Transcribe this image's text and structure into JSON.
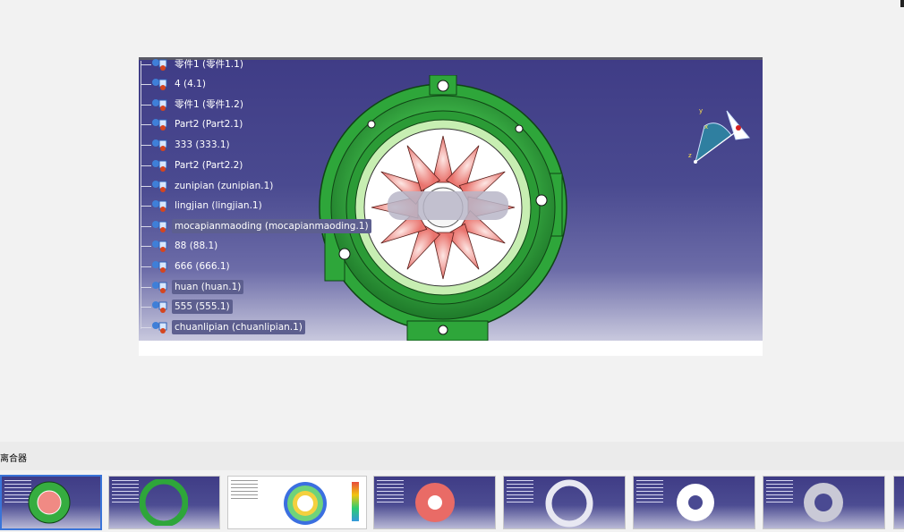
{
  "tree": {
    "items": [
      {
        "label": "零件1 (零件1.1)",
        "selected": false
      },
      {
        "label": "4 (4.1)",
        "selected": false
      },
      {
        "label": "零件1 (零件1.2)",
        "selected": false
      },
      {
        "label": "Part2 (Part2.1)",
        "selected": false
      },
      {
        "label": "333 (333.1)",
        "selected": false
      },
      {
        "label": "Part2 (Part2.2)",
        "selected": false
      },
      {
        "label": "zunipian (zunipian.1)",
        "selected": false
      },
      {
        "label": "lingjian (lingjian.1)",
        "selected": false
      },
      {
        "label": "mocapianmaoding (mocapianmaoding.1)",
        "selected": true
      },
      {
        "label": "88 (88.1)",
        "selected": false
      },
      {
        "label": "666 (666.1)",
        "selected": false
      },
      {
        "label": "huan (huan.1)",
        "selected": true
      },
      {
        "label": "555 (555.1)",
        "selected": true
      },
      {
        "label": "chuanlipian (chuanlipian.1)",
        "selected": true
      }
    ]
  },
  "compass": {
    "x_label": "x",
    "y_label": "y",
    "z_label": "z"
  },
  "strip": {
    "label": "离合器"
  },
  "thumbnails": [
    "clutch-assembly",
    "green-ring",
    "stress-analysis",
    "red-disc",
    "white-ring-holes",
    "hub-with-slots",
    "flange-disc",
    "partial"
  ],
  "colors": {
    "viewport_top": "#3f3c86",
    "part_green": "#3fb94a",
    "spring_pink": "#f08a84",
    "selection": "#5d5f8f",
    "active_thumb_border": "#3a74d8"
  }
}
